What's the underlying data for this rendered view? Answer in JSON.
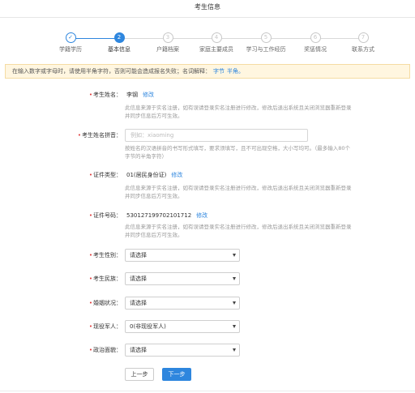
{
  "header": {
    "title": "考生信息"
  },
  "steps": [
    {
      "num": "",
      "label": "学籍学历",
      "state": "done"
    },
    {
      "num": "2",
      "label": "基本信息",
      "state": "active"
    },
    {
      "num": "3",
      "label": "户籍档案",
      "state": "todo"
    },
    {
      "num": "4",
      "label": "家庭主要成员",
      "state": "todo"
    },
    {
      "num": "5",
      "label": "学习与工作经历",
      "state": "todo"
    },
    {
      "num": "6",
      "label": "奖惩情况",
      "state": "todo"
    },
    {
      "num": "7",
      "label": "联系方式",
      "state": "todo"
    }
  ],
  "notice": {
    "text": "在输入数字或字母时，请使用半角字符，否则可能会造成报名失败；名词解释：",
    "link1": "字节",
    "link2": "半角。"
  },
  "form": {
    "name": {
      "label": "考生姓名：",
      "value": "李钢",
      "edit": "修改",
      "hint1": "此信息来源于实名注册，如有误请登录实名注册进行修改，修改后退出系统且关闭浏览器重新登录",
      "hint2": "并同步信息后方可生效。"
    },
    "pinyin": {
      "label": "考生姓名拼音：",
      "placeholder": "例如：xiaoming",
      "hint1": "按姓名的汉语拼音的书写形式填写，要求须填写，且不可出现空格，大小写均可。（最多输入80个",
      "hint2": "字节的半角字符）"
    },
    "idtype": {
      "label": "证件类型：",
      "value": "01(居民身份证)",
      "edit": "修改",
      "hint1": "此信息来源于实名注册，如有误请登录实名注册进行修改，修改后退出系统且关闭浏览器重新登录",
      "hint2": "并同步信息后方可生效。"
    },
    "idno": {
      "label": "证件号码：",
      "value": "530127199702101712",
      "edit": "修改",
      "hint1": "此信息来源于实名注册，如有误请登录实名注册进行修改，修改后退出系统且关闭浏览器重新登录",
      "hint2": "并同步信息后方可生效。"
    },
    "gender": {
      "label": "考生性别：",
      "value": "请选择"
    },
    "nation": {
      "label": "考生民族：",
      "value": "请选择"
    },
    "marital": {
      "label": "婚姻状况：",
      "value": "请选择"
    },
    "soldier": {
      "label": "现役军人：",
      "value": "0(非现役军人)"
    },
    "political": {
      "label": "政治面貌：",
      "value": "请选择"
    }
  },
  "buttons": {
    "prev": "上一步",
    "next": "下一步"
  }
}
